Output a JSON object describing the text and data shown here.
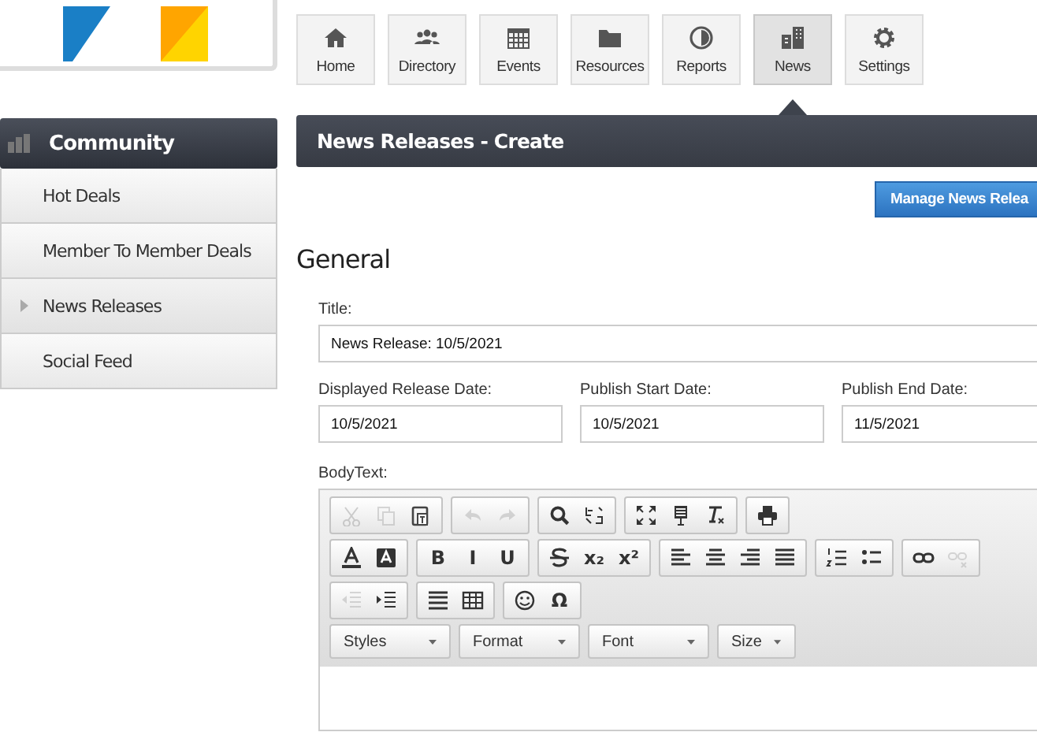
{
  "nav": [
    {
      "label": "Home",
      "selected": false
    },
    {
      "label": "Directory",
      "selected": false
    },
    {
      "label": "Events",
      "selected": false
    },
    {
      "label": "Resources",
      "selected": false
    },
    {
      "label": "Reports",
      "selected": false
    },
    {
      "label": "News",
      "selected": true
    },
    {
      "label": "Settings",
      "selected": false
    }
  ],
  "sidebar": {
    "title": "Community",
    "items": [
      {
        "label": "Hot Deals",
        "selected": false
      },
      {
        "label": "Member To Member Deals",
        "selected": false
      },
      {
        "label": "News Releases",
        "selected": true
      },
      {
        "label": "Social Feed",
        "selected": false
      }
    ]
  },
  "page_title": "News Releases - Create",
  "manage_button": "Manage News Relea",
  "section": "General",
  "title_field": {
    "label": "Title:",
    "value": "News Release: 10/5/2021"
  },
  "date_fields": [
    {
      "label": "Displayed Release Date:",
      "value": "10/5/2021"
    },
    {
      "label": "Publish Start Date:",
      "value": "10/5/2021"
    },
    {
      "label": "Publish End Date:",
      "value": "11/5/2021"
    }
  ],
  "editor": {
    "label": "BodyText:",
    "toolbar_rows": [
      [
        [
          {
            "disabled": true
          },
          {
            "disabled": true
          },
          {
            "disabled": false
          }
        ],
        [
          {
            "disabled": true
          },
          {
            "disabled": true
          }
        ],
        [
          {
            "disabled": false
          },
          {
            "disabled": false
          }
        ],
        [
          {
            "disabled": false
          },
          {
            "disabled": false
          },
          {
            "disabled": false
          }
        ],
        [
          {
            "disabled": false
          }
        ]
      ],
      [
        [
          {
            "disabled": false
          },
          {
            "disabled": false
          }
        ],
        [
          {
            "disabled": false,
            "label": "B"
          },
          {
            "disabled": false,
            "label": "I"
          },
          {
            "disabled": false,
            "label": "U"
          }
        ],
        [
          {
            "disabled": false
          },
          {
            "disabled": false,
            "label": "x₂"
          },
          {
            "disabled": false,
            "label": "x²"
          }
        ],
        [
          {
            "disabled": false
          },
          {
            "disabled": false
          },
          {
            "disabled": false
          },
          {
            "disabled": false
          }
        ],
        [
          {
            "disabled": false
          },
          {
            "disabled": false
          }
        ],
        [
          {
            "disabled": false
          },
          {
            "disabled": true
          }
        ]
      ],
      [
        [
          {
            "disabled": true
          },
          {
            "disabled": false
          }
        ],
        [
          {
            "disabled": false
          },
          {
            "disabled": false
          }
        ],
        [
          {
            "disabled": false
          },
          {
            "disabled": false,
            "label": "Ω"
          }
        ]
      ]
    ],
    "dropdowns": [
      "Styles",
      "Format",
      "Font",
      "Size"
    ]
  }
}
